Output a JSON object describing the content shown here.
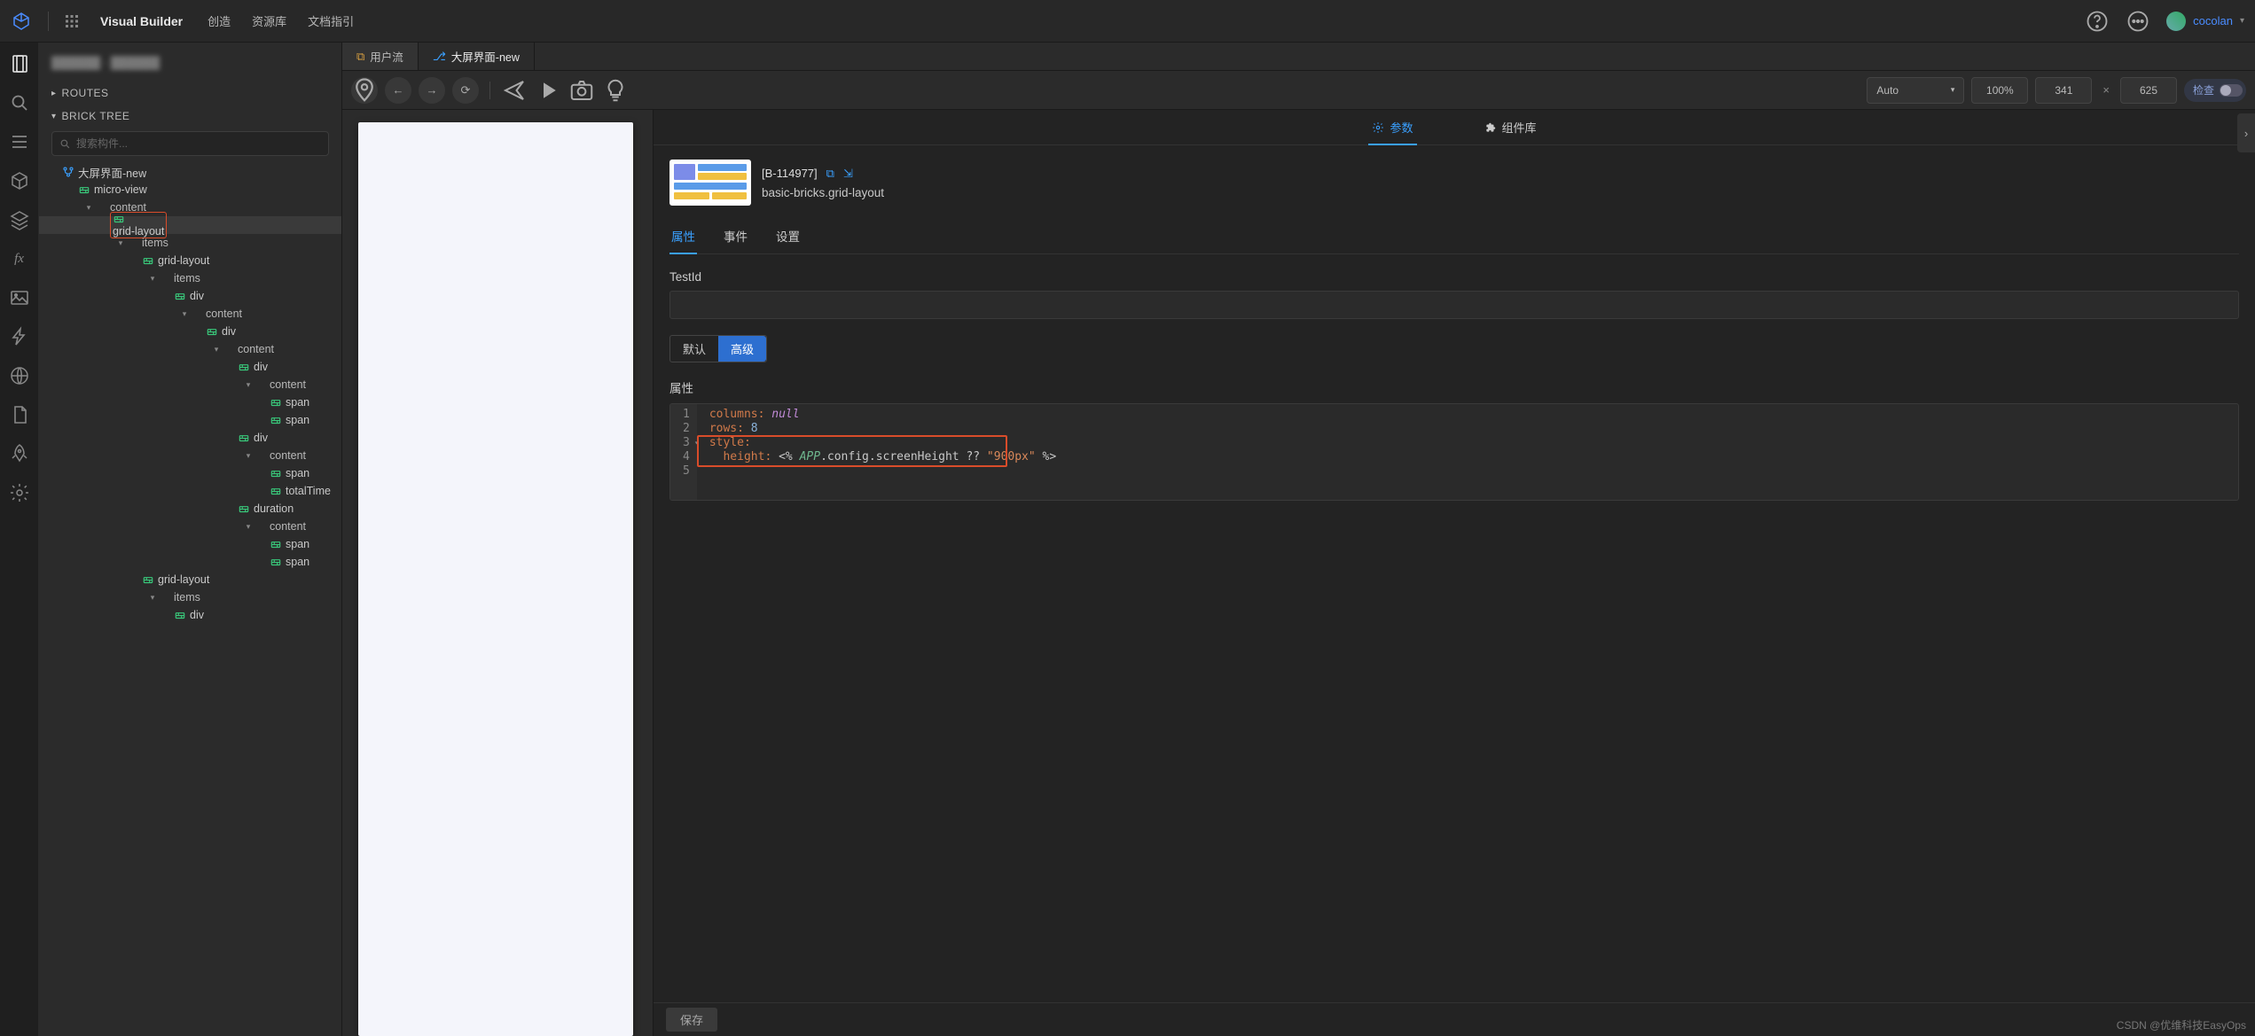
{
  "topbar": {
    "title": "Visual Builder",
    "nav": [
      "创造",
      "资源库",
      "文档指引"
    ],
    "user": "cocolan"
  },
  "side": {
    "project": "██████ - ██████",
    "routes_label": "ROUTES",
    "tree_label": "BRICK TREE",
    "search_placeholder": "搜索构件...",
    "tree": [
      {
        "d": 0,
        "t": "branch",
        "twist": "",
        "label": "大屏界面-new"
      },
      {
        "d": 1,
        "t": "brick",
        "twist": "",
        "label": "micro-view"
      },
      {
        "d": 2,
        "t": "slot",
        "twist": "v",
        "label": "content"
      },
      {
        "d": 3,
        "t": "brick",
        "twist": "",
        "label": "grid-layout",
        "sel": true,
        "hl": true
      },
      {
        "d": 4,
        "t": "slot",
        "twist": "v",
        "label": "items"
      },
      {
        "d": 5,
        "t": "brick",
        "twist": "",
        "label": "grid-layout"
      },
      {
        "d": 6,
        "t": "slot",
        "twist": "v",
        "label": "items"
      },
      {
        "d": 7,
        "t": "brick",
        "twist": "",
        "label": "div"
      },
      {
        "d": 8,
        "t": "slot",
        "twist": "v",
        "label": "content"
      },
      {
        "d": 9,
        "t": "brick",
        "twist": "",
        "label": "div"
      },
      {
        "d": 10,
        "t": "slot",
        "twist": "v",
        "label": "content"
      },
      {
        "d": 11,
        "t": "brick",
        "twist": "",
        "label": "div"
      },
      {
        "d": 12,
        "t": "slot",
        "twist": "v",
        "label": "content"
      },
      {
        "d": 13,
        "t": "brick",
        "twist": "",
        "label": "span"
      },
      {
        "d": 13,
        "t": "brick",
        "twist": "",
        "label": "span"
      },
      {
        "d": 11,
        "t": "brick",
        "twist": "",
        "label": "div"
      },
      {
        "d": 12,
        "t": "slot",
        "twist": "v",
        "label": "content"
      },
      {
        "d": 13,
        "t": "brick",
        "twist": "",
        "label": "span"
      },
      {
        "d": 13,
        "t": "brick",
        "twist": "",
        "label": "totalTime"
      },
      {
        "d": 11,
        "t": "brick",
        "twist": "",
        "label": "duration"
      },
      {
        "d": 12,
        "t": "slot",
        "twist": "v",
        "label": "content"
      },
      {
        "d": 13,
        "t": "brick",
        "twist": "",
        "label": "span"
      },
      {
        "d": 13,
        "t": "brick",
        "twist": "",
        "label": "span"
      },
      {
        "d": 5,
        "t": "brick",
        "twist": "",
        "label": "grid-layout"
      },
      {
        "d": 6,
        "t": "slot",
        "twist": "v",
        "label": "items"
      },
      {
        "d": 7,
        "t": "brick",
        "twist": "",
        "label": "div"
      }
    ]
  },
  "tabs": {
    "items": [
      {
        "icon": "monitor",
        "label": "用户流",
        "active": false,
        "color": "#d8a040"
      },
      {
        "icon": "branch",
        "label": "大屏界面-new",
        "active": true,
        "color": "#3aa0ff"
      }
    ]
  },
  "toolbar": {
    "mode": "Auto",
    "zoom": "100%",
    "width": "341",
    "height": "625",
    "inspect": "检查"
  },
  "right": {
    "tabs": {
      "params": "参数",
      "lib": "组件库"
    },
    "brick_id": "[B-114977]",
    "brick_name": "basic-bricks.grid-layout",
    "sub_tabs": {
      "props": "属性",
      "events": "事件",
      "settings": "设置"
    },
    "testid_label": "TestId",
    "testid_value": "",
    "seg": {
      "default": "默认",
      "adv": "高级"
    },
    "props_label": "属性",
    "code": {
      "l1_key": "columns:",
      "l1_val": "null",
      "l2_key": "rows:",
      "l2_val": "8",
      "l3_key": "style:",
      "l4_key": "height:",
      "l4_op": "<%",
      "l4_var": "APP",
      "l4_path": ".config.screenHeight ?? ",
      "l4_str": "\"900px\"",
      "l4_cl": " %>"
    },
    "save": "保存"
  },
  "watermark": "CSDN @优维科技EasyOps"
}
